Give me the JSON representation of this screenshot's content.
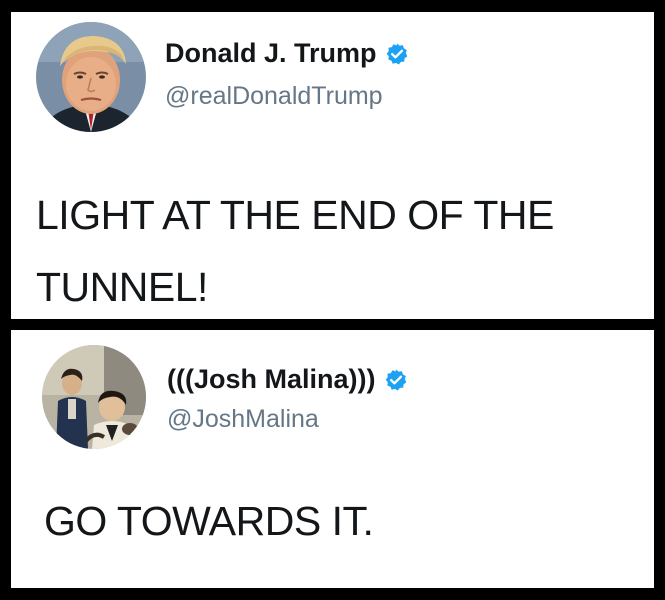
{
  "tweets": [
    {
      "display_name": "Donald J. Trump",
      "handle": "@realDonaldTrump",
      "verified": true,
      "text": "LIGHT AT THE END OF THE TUNNEL!",
      "avatar_icon": "portrait-avatar"
    },
    {
      "display_name": "(((Josh Malina)))",
      "handle": "@JoshMalina",
      "verified": true,
      "text": "GO TOWARDS IT.",
      "avatar_icon": "vintage-photo-avatar"
    }
  ],
  "colors": {
    "background": "#000000",
    "card": "#ffffff",
    "text": "#14171a",
    "handle": "#657786",
    "verified_badge": "#1da1f2"
  }
}
